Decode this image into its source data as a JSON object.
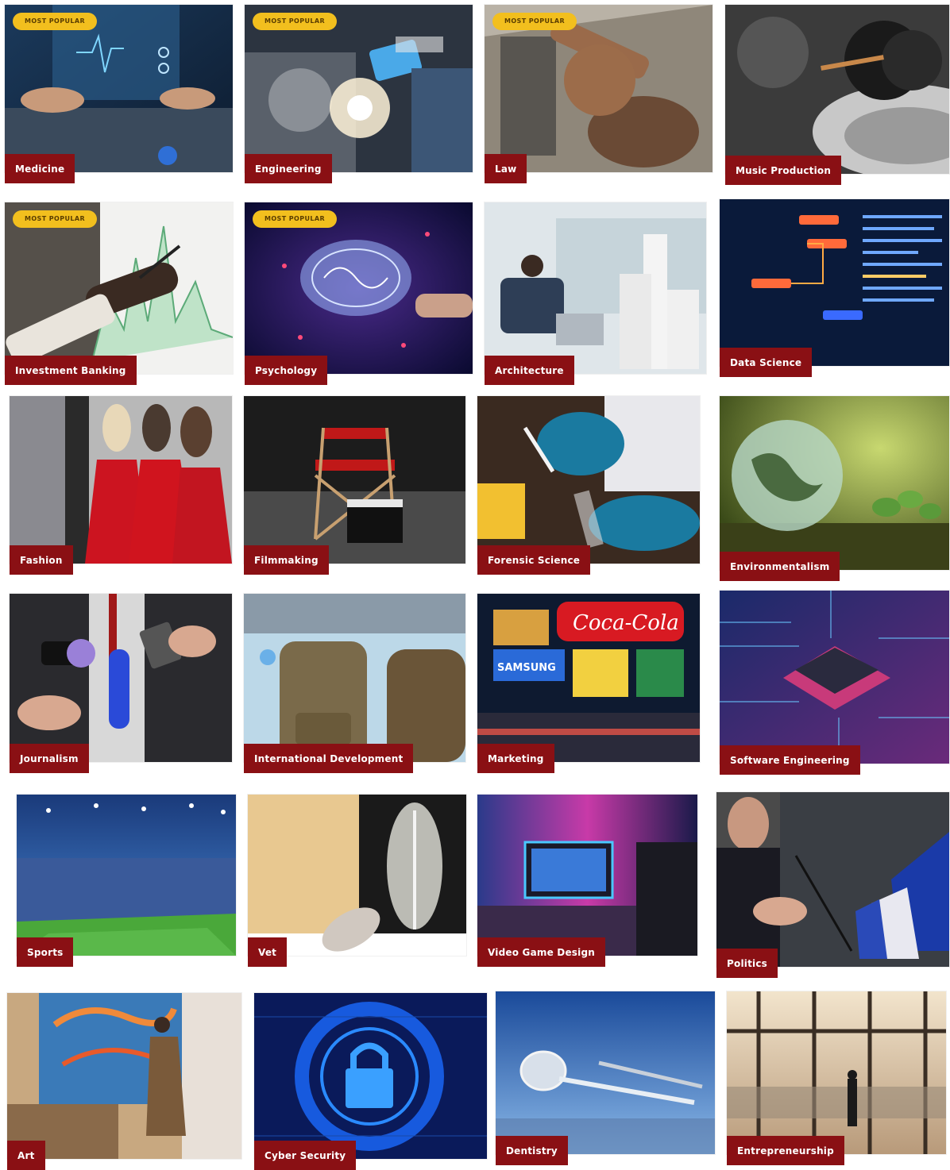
{
  "badge_text": "MOST POPULAR",
  "label_color": "#8a1014",
  "badge_color": "#f2bf1e",
  "cards": [
    {
      "label": "Medicine",
      "icon": "medicine-image",
      "badge": true
    },
    {
      "label": "Engineering",
      "icon": "engineering-image",
      "badge": true
    },
    {
      "label": "Law",
      "icon": "law-gavel-image",
      "badge": true
    },
    {
      "label": "Music Production",
      "icon": "music-turntable-image",
      "badge": false
    },
    {
      "label": "Investment Banking",
      "icon": "investment-chart-image",
      "badge": true
    },
    {
      "label": "Psychology",
      "icon": "psychology-brain-image",
      "badge": true
    },
    {
      "label": "Architecture",
      "icon": "architecture-model-image",
      "badge": false
    },
    {
      "label": "Data Science",
      "icon": "data-science-code-image",
      "badge": false
    },
    {
      "label": "Fashion",
      "icon": "fashion-runway-image",
      "badge": false
    },
    {
      "label": "Filmmaking",
      "icon": "filmmaking-chair-image",
      "badge": false
    },
    {
      "label": "Forensic Science",
      "icon": "forensic-evidence-image",
      "badge": false
    },
    {
      "label": "Environmentalism",
      "icon": "environment-globe-image",
      "badge": false
    },
    {
      "label": "Journalism",
      "icon": "journalism-microphones-image",
      "badge": false
    },
    {
      "label": "International Development",
      "icon": "aid-bags-image",
      "badge": false
    },
    {
      "label": "Marketing",
      "icon": "marketing-billboards-image",
      "badge": false
    },
    {
      "label": "Software Engineering",
      "icon": "software-chip-image",
      "badge": false
    },
    {
      "label": "Sports",
      "icon": "sports-stadium-image",
      "badge": false
    },
    {
      "label": "Vet",
      "icon": "vet-xray-image",
      "badge": false
    },
    {
      "label": "Video Game Design",
      "icon": "gaming-setup-image",
      "badge": false
    },
    {
      "label": "Politics",
      "icon": "politics-podium-image",
      "badge": false
    },
    {
      "label": "Art",
      "icon": "art-painter-image",
      "badge": false
    },
    {
      "label": "Cyber Security",
      "icon": "cyber-lock-image",
      "badge": false
    },
    {
      "label": "Dentistry",
      "icon": "dentistry-tools-image",
      "badge": false
    },
    {
      "label": "Entrepreneurship",
      "icon": "entrepreneur-window-image",
      "badge": false
    }
  ]
}
